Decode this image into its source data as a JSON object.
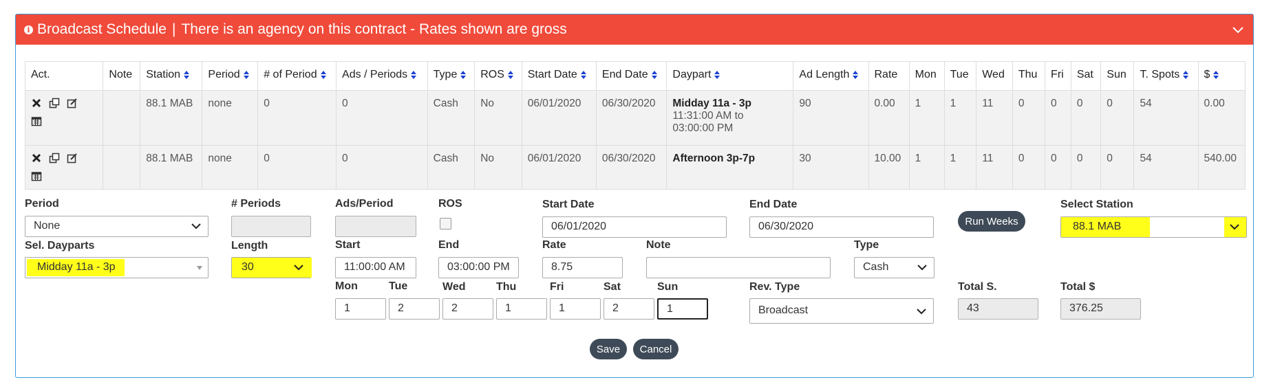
{
  "header": {
    "title": "Broadcast Schedule",
    "separator": "|",
    "message": "There is an agency on this contract - Rates shown are gross"
  },
  "table": {
    "columns": [
      "Act.",
      "Note",
      "Station",
      "Period",
      "# of Period",
      "Ads / Periods",
      "Type",
      "ROS",
      "Start Date",
      "End Date",
      "Daypart",
      "Ad Length",
      "Rate",
      "Mon",
      "Tue",
      "Wed",
      "Thu",
      "Fri",
      "Sat",
      "Sun",
      "T. Spots",
      "$"
    ],
    "rows": [
      {
        "note": "",
        "station": "88.1 MAB",
        "period": "none",
        "num_period": "0",
        "ads_periods": "0",
        "type": "Cash",
        "ros": "No",
        "start": "06/01/2020",
        "end": "06/30/2020",
        "daypart": "Midday 11a - 3p",
        "daypart_time": "11:31:00 AM to 03:00:00 PM",
        "ad_length": "90",
        "rate": "0.00",
        "mon": "1",
        "tue": "1",
        "wed": "11",
        "thu": "0",
        "fri": "0",
        "sat": "0",
        "sun": "0",
        "spots": "54",
        "dollars": "0.00"
      },
      {
        "note": "",
        "station": "88.1 MAB",
        "period": "none",
        "num_period": "0",
        "ads_periods": "0",
        "type": "Cash",
        "ros": "No",
        "start": "06/01/2020",
        "end": "06/30/2020",
        "daypart": "Afternoon 3p-7p",
        "daypart_time": "",
        "ad_length": "30",
        "rate": "10.00",
        "mon": "1",
        "tue": "1",
        "wed": "11",
        "thu": "0",
        "fri": "0",
        "sat": "0",
        "sun": "0",
        "spots": "54",
        "dollars": "540.00"
      }
    ]
  },
  "form": {
    "period_label": "Period",
    "period_value": "None",
    "num_periods_label": "# Periods",
    "num_periods_value": "",
    "ads_period_label": "Ads/Period",
    "ads_period_value": "",
    "ros_label": "ROS",
    "start_date_label": "Start Date",
    "start_date_value": "06/01/2020",
    "end_date_label": "End Date",
    "end_date_value": "06/30/2020",
    "run_weeks_label": "Run Weeks",
    "select_station_label": "Select Station",
    "select_station_value": "88.1 MAB",
    "sel_dayparts_label": "Sel. Dayparts",
    "sel_dayparts_value": "Midday 11a - 3p",
    "length_label": "Length",
    "length_value": "30",
    "start_label": "Start",
    "start_value": "11:00:00 AM",
    "end_label": "End",
    "end_value": "03:00:00 PM",
    "rate_label": "Rate",
    "rate_value": "8.75",
    "note_label": "Note",
    "note_value": "",
    "type_label": "Type",
    "type_value": "Cash",
    "days": [
      {
        "label": "Mon",
        "value": "1"
      },
      {
        "label": "Tue",
        "value": "2"
      },
      {
        "label": "Wed",
        "value": "2"
      },
      {
        "label": "Thu",
        "value": "1"
      },
      {
        "label": "Fri",
        "value": "1"
      },
      {
        "label": "Sat",
        "value": "2"
      },
      {
        "label": "Sun",
        "value": "1"
      }
    ],
    "rev_type_label": "Rev. Type",
    "rev_type_value": "Broadcast",
    "total_s_label": "Total S.",
    "total_s_value": "43",
    "total_dollar_label": "Total $",
    "total_dollar_value": "376.25",
    "save_label": "Save",
    "cancel_label": "Cancel"
  },
  "colors": {
    "header_bg": "#f04a3a",
    "panel_border": "#3a9bd8",
    "highlight": "#ffff1a",
    "button_bg": "#3e4a57",
    "sort_arrow": "#1a3fd0"
  }
}
